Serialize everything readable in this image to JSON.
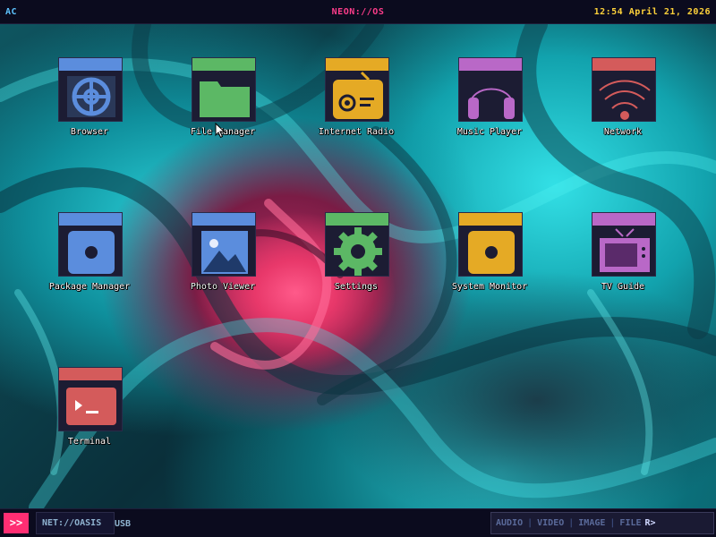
{
  "topbar": {
    "left_label": "AC",
    "title": "NEON://OS",
    "clock": "12:54 April 21, 2026"
  },
  "colors": {
    "blue": "#5b8ddd",
    "green": "#5cb865",
    "yellow": "#e5aa25",
    "purple": "#b968c7",
    "red": "#d45b5b",
    "accent_pink": "#ff2e73",
    "clock_yellow": "#ffd23a"
  },
  "icons": [
    {
      "label": "Browser",
      "icon": "globe-icon",
      "color": "blue"
    },
    {
      "label": "File Manager",
      "icon": "folder-icon",
      "color": "green"
    },
    {
      "label": "Internet Radio",
      "icon": "radio-icon",
      "color": "yellow"
    },
    {
      "label": "Music Player",
      "icon": "headphones-icon",
      "color": "purple"
    },
    {
      "label": "Network",
      "icon": "wifi-icon",
      "color": "red"
    },
    {
      "label": "Package Manager",
      "icon": "package-icon",
      "color": "blue"
    },
    {
      "label": "Photo Viewer",
      "icon": "image-icon",
      "color": "blue"
    },
    {
      "label": "Settings",
      "icon": "gear-icon",
      "color": "green"
    },
    {
      "label": "System Monitor",
      "icon": "monitor-icon",
      "color": "yellow"
    },
    {
      "label": "TV Guide",
      "icon": "tv-icon",
      "color": "purple"
    },
    {
      "label": "Terminal",
      "icon": "terminal-icon",
      "color": "red"
    }
  ],
  "bottombar": {
    "start_label": ">>",
    "network_label": "NET://OASIS",
    "usb_label": "USB",
    "media": {
      "audio": "AUDIO",
      "video": "VIDEO",
      "image": "IMAGE",
      "file": "FILE",
      "next": "R>"
    }
  }
}
